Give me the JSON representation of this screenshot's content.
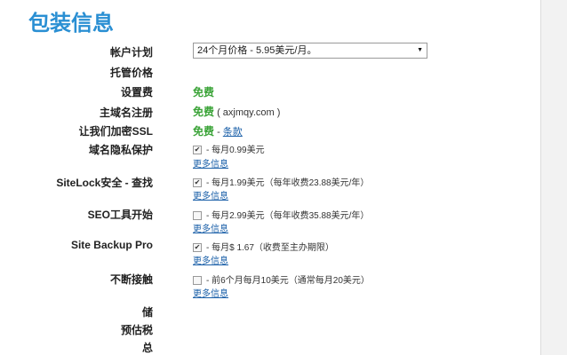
{
  "title": "包装信息",
  "rows": {
    "plan": {
      "label": "帐户计划",
      "selected": "24个月价格 - 5.95美元/月。"
    },
    "hosting_price": {
      "label": "托管价格"
    },
    "setup_fee": {
      "label": "设置费",
      "value": "免费"
    },
    "domain_reg": {
      "label": "主域名注册",
      "value": "免费",
      "domain": "( axjmqy.com )"
    },
    "ssl": {
      "label": "让我们加密SSL",
      "value": "免费",
      "sep": " - ",
      "link": "条款"
    },
    "privacy": {
      "label": "域名隐私保护",
      "text": "- 每月0.99美元",
      "more": "更多信息"
    },
    "sitelock": {
      "label": "SiteLock安全 - 查找",
      "text": "- 每月1.99美元（每年收费23.88美元/年）",
      "more": "更多信息"
    },
    "seo": {
      "label": "SEO工具开始",
      "text": "- 每月2.99美元（每年收费35.88美元/年）",
      "more": "更多信息"
    },
    "backup": {
      "label": "Site Backup Pro",
      "text": "- 每月$ 1.67（收费至主办期限）",
      "more": "更多信息"
    },
    "continuity": {
      "label": "不断接触",
      "text": "- 前6个月每月10美元（通常每月20美元）",
      "more": "更多信息"
    },
    "savings": {
      "label": "储"
    },
    "tax": {
      "label": "预估税"
    },
    "total": {
      "label": "总"
    }
  },
  "checkbox_states": {
    "privacy": true,
    "sitelock": true,
    "seo": false,
    "backup": true,
    "continuity": false
  }
}
